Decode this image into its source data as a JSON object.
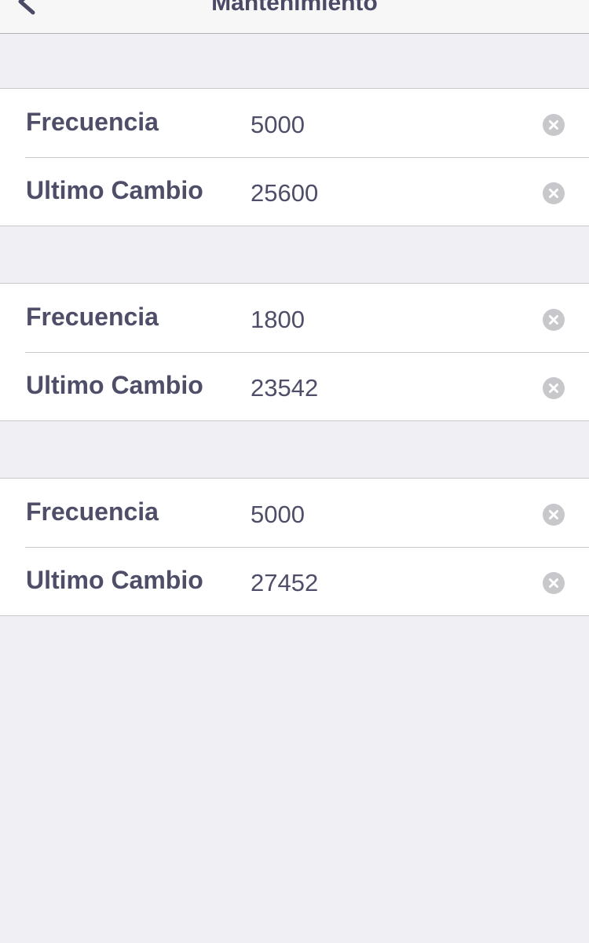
{
  "nav": {
    "title": "Mantenimiento",
    "back_icon": "chevron-left-icon"
  },
  "groups": [
    {
      "rows": [
        {
          "label": "Frecuencia",
          "value": "5000",
          "icon": "clear-circle-icon"
        },
        {
          "label": "Ultimo Cambio",
          "value": "25600",
          "icon": "clear-circle-icon"
        }
      ]
    },
    {
      "rows": [
        {
          "label": "Frecuencia",
          "value": "1800",
          "icon": "clear-circle-icon"
        },
        {
          "label": "Ultimo Cambio",
          "value": "23542",
          "icon": "clear-circle-icon"
        }
      ]
    },
    {
      "rows": [
        {
          "label": "Frecuencia",
          "value": "5000",
          "icon": "clear-circle-icon"
        },
        {
          "label": "Ultimo Cambio",
          "value": "27452",
          "icon": "clear-circle-icon"
        }
      ]
    }
  ],
  "colors": {
    "background": "#efeff4",
    "text": "#4e4e69",
    "separator": "#c8c7cc",
    "clear_button": "#c7c7cc"
  }
}
